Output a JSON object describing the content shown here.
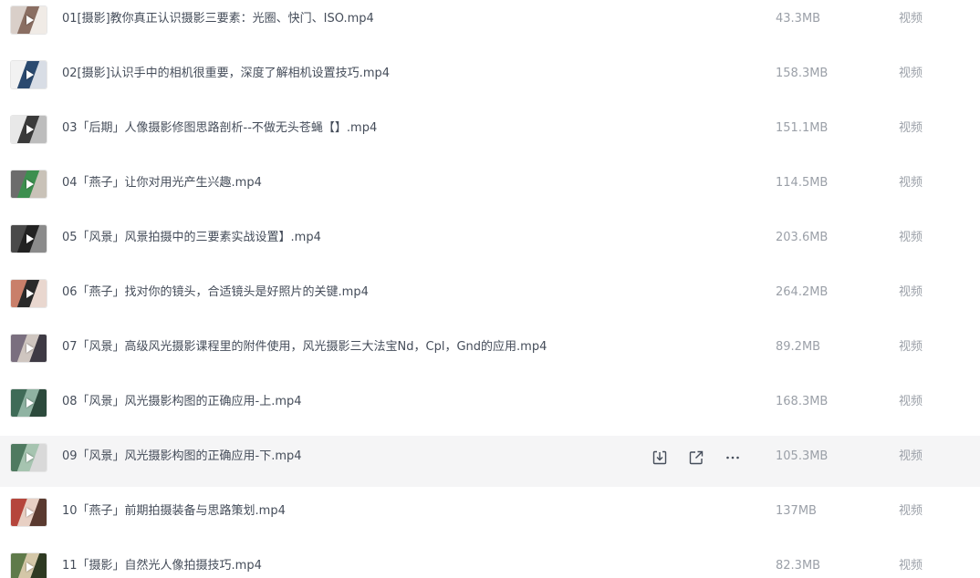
{
  "files": [
    {
      "name": "01[摄影]教你真正认识摄影三要素：光圈、快门、ISO.mp4",
      "size": "43.3MB",
      "type": "视频",
      "thumb": [
        "#d9cfc9",
        "#8a6e62",
        "#f0ebe6"
      ]
    },
    {
      "name": "02[摄影]认识手中的相机很重要，深度了解相机设置技巧.mp4",
      "size": "158.3MB",
      "type": "视频",
      "thumb": [
        "#f2f2f2",
        "#2b4a6f",
        "#d8dde5"
      ]
    },
    {
      "name": "03「后期」人像摄影修图思路剖析--不做无头苍蝇【】.mp4",
      "size": "151.1MB",
      "type": "视频",
      "thumb": [
        "#e8e8e8",
        "#3a3a3a",
        "#bdbdbd"
      ]
    },
    {
      "name": "04「燕子」让你对用光产生兴趣.mp4",
      "size": "114.5MB",
      "type": "视频",
      "thumb": [
        "#6c6c6c",
        "#3d8f4f",
        "#c9c2b8"
      ]
    },
    {
      "name": "05「风景」风景拍摄中的三要素实战设置】.mp4",
      "size": "203.6MB",
      "type": "视频",
      "thumb": [
        "#4a4a4a",
        "#222222",
        "#8b8b8b"
      ]
    },
    {
      "name": "06「燕子」找对你的镜头，合适镜头是好照片的关键.mp4",
      "size": "264.2MB",
      "type": "视频",
      "thumb": [
        "#c97f6a",
        "#2a2a2a",
        "#e9d7cf"
      ]
    },
    {
      "name": "07「风景」高级风光摄影课程里的附件使用，风光摄影三大法宝Nd，Cpl，Gnd的应用.mp4",
      "size": "89.2MB",
      "type": "视频",
      "thumb": [
        "#7a6f7f",
        "#cfc6c0",
        "#3e3a44"
      ]
    },
    {
      "name": "08「风景」风光摄影构图的正确应用-上.mp4",
      "size": "168.3MB",
      "type": "视频",
      "thumb": [
        "#3f6b57",
        "#8fb3a2",
        "#2c4a3c"
      ]
    },
    {
      "name": "09「风景」风光摄影构图的正确应用-下.mp4",
      "size": "105.3MB",
      "type": "视频",
      "thumb": [
        "#4f7a60",
        "#a6c4b0",
        "#d9d9d9"
      ]
    },
    {
      "name": "10「燕子」前期拍摄装备与思路策划.mp4",
      "size": "137MB",
      "type": "视频",
      "thumb": [
        "#b5463c",
        "#e8d0c4",
        "#5a3a30"
      ]
    },
    {
      "name": "11「摄影」自然光人像拍摄技巧.mp4",
      "size": "82.3MB",
      "type": "视频",
      "thumb": [
        "#5f7a4a",
        "#d4c7a8",
        "#2e3a22"
      ]
    }
  ],
  "hovered_index": 8,
  "actions": [
    {
      "icon": "download-icon",
      "label": "下载"
    },
    {
      "icon": "share-icon",
      "label": "分享"
    },
    {
      "icon": "more-icon",
      "label": "更多"
    }
  ],
  "colors": {
    "name_text": "#454d5a",
    "meta_text": "#9ba0a8",
    "hover_bg": "#f5f5f6",
    "icon": "#454d5a"
  }
}
